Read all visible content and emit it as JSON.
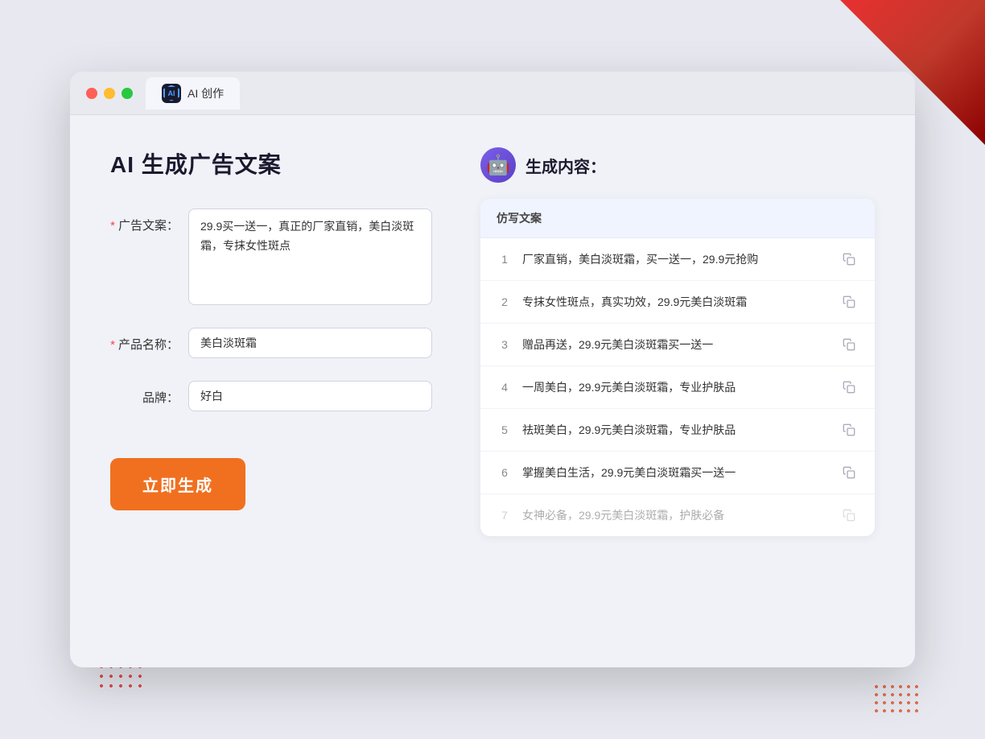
{
  "background": {
    "triangle_color": "#cc2222"
  },
  "browser": {
    "tab_icon_text": "AI",
    "tab_label": "AI 创作"
  },
  "left_panel": {
    "page_title": "AI 生成广告文案",
    "form": {
      "ad_copy_label": "广告文案：",
      "ad_copy_required": true,
      "ad_copy_value": "29.9买一送一，真正的厂家直销，美白淡斑霜，专抹女性斑点",
      "product_name_label": "产品名称：",
      "product_name_required": true,
      "product_name_value": "美白淡斑霜",
      "brand_label": "品牌：",
      "brand_required": false,
      "brand_value": "好白"
    },
    "generate_button": "立即生成"
  },
  "right_panel": {
    "section_title": "生成内容：",
    "table_header": "仿写文案",
    "results": [
      {
        "id": 1,
        "text": "厂家直销，美白淡斑霜，买一送一，29.9元抢购",
        "faded": false
      },
      {
        "id": 2,
        "text": "专抹女性斑点，真实功效，29.9元美白淡斑霜",
        "faded": false
      },
      {
        "id": 3,
        "text": "赠品再送，29.9元美白淡斑霜买一送一",
        "faded": false
      },
      {
        "id": 4,
        "text": "一周美白，29.9元美白淡斑霜，专业护肤品",
        "faded": false
      },
      {
        "id": 5,
        "text": "祛斑美白，29.9元美白淡斑霜，专业护肤品",
        "faded": false
      },
      {
        "id": 6,
        "text": "掌握美白生活，29.9元美白淡斑霜买一送一",
        "faded": false
      },
      {
        "id": 7,
        "text": "女神必备，29.9元美白淡斑霜，护肤必备",
        "faded": true
      }
    ]
  }
}
